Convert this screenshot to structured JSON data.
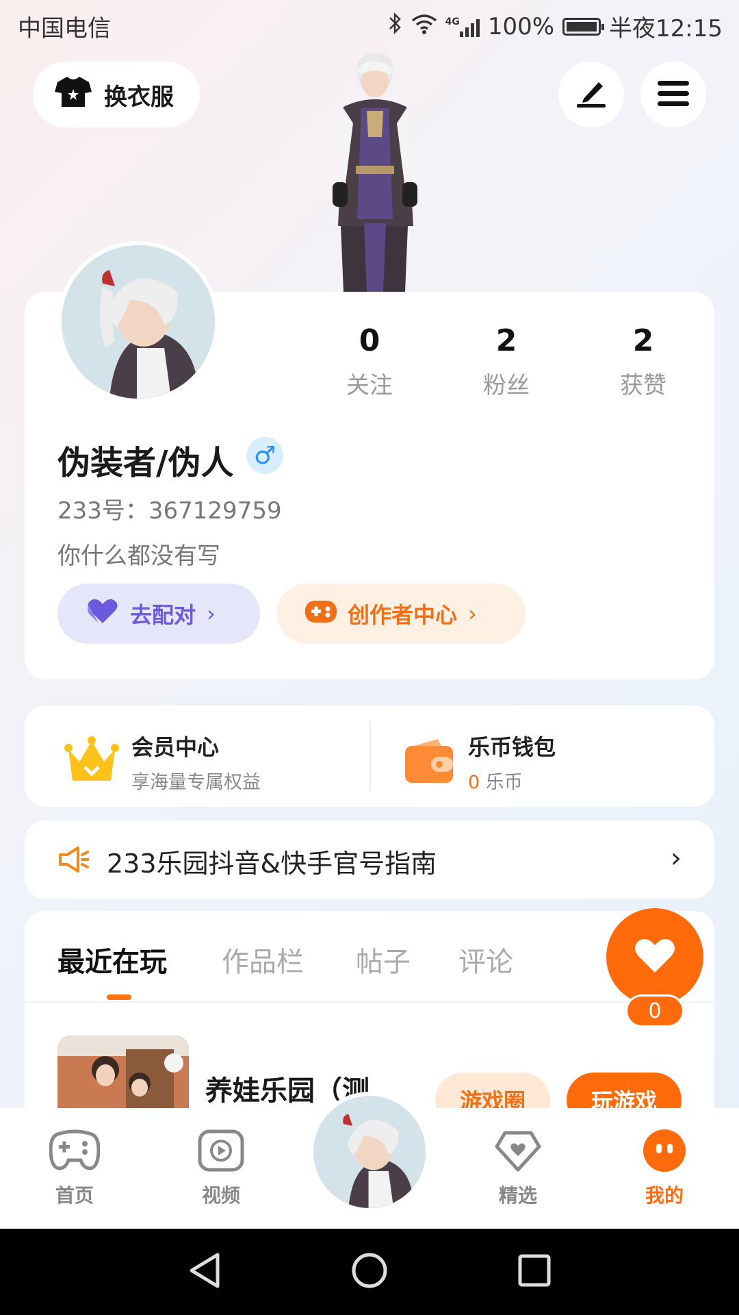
{
  "status_bar": {
    "carrier": "中国电信",
    "network": "4G",
    "battery": "100%",
    "time": "半夜12:15"
  },
  "top": {
    "outfit_label": "换衣服",
    "edit_icon": "pen-icon",
    "menu_icon": "hamburger-menu-icon"
  },
  "profile": {
    "stats": [
      {
        "value": "0",
        "label": "关注"
      },
      {
        "value": "2",
        "label": "粉丝"
      },
      {
        "value": "2",
        "label": "获赞"
      }
    ],
    "name": "伪装者/伪人",
    "gender_symbol": "♂",
    "uid": "233号：367129759",
    "bio": "你什么都没有写",
    "match_label": "去配对",
    "creator_label": "创作者中心"
  },
  "member": {
    "title": "会员中心",
    "subtitle": "享海量专属权益"
  },
  "wallet": {
    "title": "乐币钱包",
    "amount": "0",
    "unit": "乐币"
  },
  "notice": {
    "text": "233乐园抖音&快手官号指南"
  },
  "tabs": [
    {
      "label": "最近在玩",
      "active": true
    },
    {
      "label": "作品栏",
      "active": false
    },
    {
      "label": "帖子",
      "active": false
    },
    {
      "label": "评论",
      "active": false
    }
  ],
  "like": {
    "count": "0"
  },
  "recent_game": {
    "name": "养娃乐园（测",
    "circle_label": "游戏圈",
    "play_label": "玩游戏"
  },
  "bottom_nav": [
    {
      "label": "首页",
      "icon": "gamepad-icon"
    },
    {
      "label": "视频",
      "icon": "video-icon"
    },
    {
      "label": "精选",
      "icon": "heart-diamond-icon"
    },
    {
      "label": "我的",
      "icon": "face-icon"
    }
  ],
  "colors": {
    "accent": "#ff6a0b",
    "match_purple": "#6b5bdc",
    "gender_blue": "#2d8ff0"
  }
}
